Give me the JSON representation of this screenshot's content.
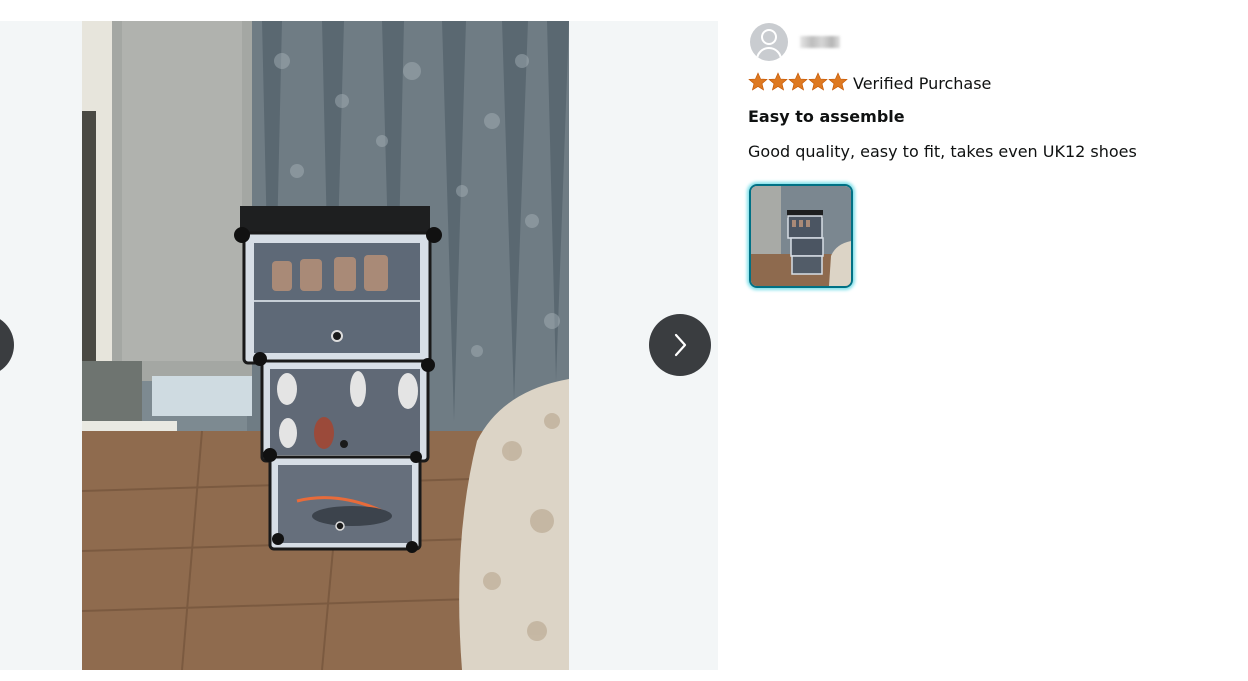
{
  "reviewer": {
    "name": ""
  },
  "review": {
    "rating": 5,
    "rating_max": 5,
    "verified_label": "Verified Purchase",
    "title": "Easy to assemble",
    "body": "Good quality, easy to fit, takes even UK12 shoes"
  },
  "icons": {
    "avatar": "user-avatar-icon",
    "next": "chevron-right-icon",
    "prev": "chevron-left-icon",
    "star": "star-icon"
  },
  "colors": {
    "star": "#de7921",
    "thumb_border": "#007185",
    "thumb_glow": "#7fe0ea",
    "nav_button": "#3a3d40"
  }
}
